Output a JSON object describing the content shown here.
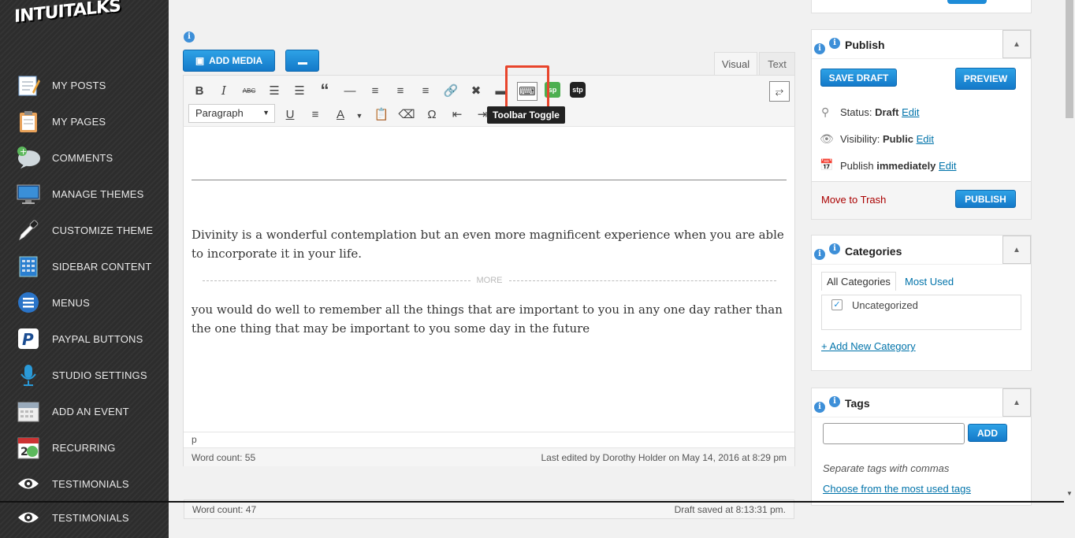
{
  "brand": {
    "logo": "INTUITALKS"
  },
  "sidebar": {
    "items": [
      {
        "label": "MY POSTS",
        "icon": "posts-icon"
      },
      {
        "label": "MY PAGES",
        "icon": "pages-icon"
      },
      {
        "label": "COMMENTS",
        "icon": "comments-icon"
      },
      {
        "label": "MANAGE THEMES",
        "icon": "themes-icon"
      },
      {
        "label": "CUSTOMIZE THEME",
        "icon": "eyedropper-icon"
      },
      {
        "label": "SIDEBAR CONTENT",
        "icon": "sidebar-icon"
      },
      {
        "label": "MENUS",
        "icon": "menus-icon"
      },
      {
        "label": "PAYPAL BUTTONS",
        "icon": "paypal-icon"
      },
      {
        "label": "STUDIO SETTINGS",
        "icon": "microphone-icon"
      },
      {
        "label": "ADD AN EVENT",
        "icon": "calendar-icon"
      },
      {
        "label": "RECURRING",
        "icon": "recurring-calendar-icon"
      },
      {
        "label": "TESTIMONIALS",
        "icon": "eye-icon"
      },
      {
        "label": "TESTIMONIALS",
        "icon": "eye-icon"
      }
    ]
  },
  "editor": {
    "add_media_label": "ADD MEDIA",
    "tabs": {
      "visual": "Visual",
      "text": "Text"
    },
    "format_select": "Paragraph",
    "tooltip": "Toolbar Toggle",
    "paragraph1": "Divinity is a wonderful contemplation but an even more magnificent experience when you are able to incorporate it in your life.",
    "more_label": "MORE",
    "paragraph2": "you would do well to remember all the things that are important to you in any one day rather than the one thing that may be important to you some day in the future",
    "path": "p",
    "word_count": "Word count: 55",
    "last_edited": "Last edited by Dorothy Holder on May 14, 2016 at 8:29 pm",
    "word_count_2": "Word count: 47",
    "draft_saved": "Draft saved at 8:13:31 pm."
  },
  "publish": {
    "title": "Publish",
    "save_draft": "SAVE DRAFT",
    "preview": "PREVIEW",
    "status_label": "Status:",
    "status_value": "Draft",
    "visibility_label": "Visibility:",
    "visibility_value": "Public",
    "publish_label": "Publish",
    "publish_value": "immediately",
    "edit": "Edit",
    "trash": "Move to Trash",
    "publish_button": "PUBLISH"
  },
  "categories": {
    "title": "Categories",
    "tab_all": "All Categories",
    "tab_most_used": "Most Used",
    "items": [
      {
        "label": "Uncategorized",
        "checked": true
      }
    ],
    "add_new": "+ Add New Category"
  },
  "tags": {
    "title": "Tags",
    "add_button": "ADD",
    "hint": "Separate tags with commas",
    "choose": "Choose from the most used tags"
  },
  "colors": {
    "accent": "#1e8cd8",
    "trash": "#a00",
    "highlight": "#e8452c"
  }
}
